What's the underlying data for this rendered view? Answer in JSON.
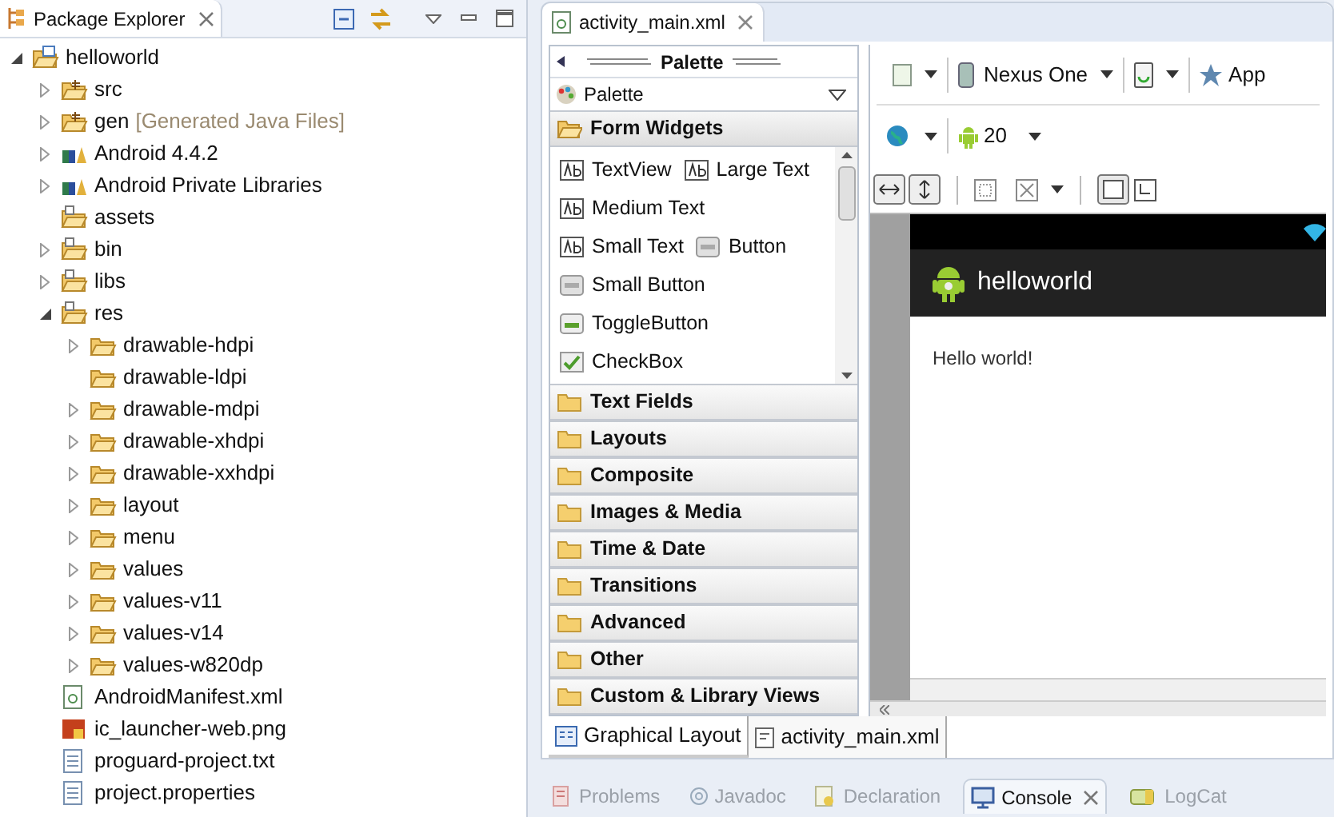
{
  "package_explorer": {
    "title": "Package Explorer",
    "tree": [
      {
        "label": "helloworld",
        "kind": "project",
        "expanded": true,
        "children": [
          {
            "label": "src",
            "kind": "package-folder",
            "expanded": false
          },
          {
            "label": "gen",
            "note": "[Generated Java Files]",
            "kind": "package-folder",
            "expanded": false
          },
          {
            "label": "Android 4.4.2",
            "kind": "library",
            "expanded": false
          },
          {
            "label": "Android Private Libraries",
            "kind": "library",
            "expanded": false
          },
          {
            "label": "assets",
            "kind": "source-folder"
          },
          {
            "label": "bin",
            "kind": "source-folder",
            "expanded": false
          },
          {
            "label": "libs",
            "kind": "source-folder",
            "expanded": false
          },
          {
            "label": "res",
            "kind": "source-folder",
            "expanded": true,
            "children": [
              {
                "label": "drawable-hdpi",
                "kind": "folder",
                "expanded": false
              },
              {
                "label": "drawable-ldpi",
                "kind": "folder"
              },
              {
                "label": "drawable-mdpi",
                "kind": "folder",
                "expanded": false
              },
              {
                "label": "drawable-xhdpi",
                "kind": "folder",
                "expanded": false
              },
              {
                "label": "drawable-xxhdpi",
                "kind": "folder",
                "expanded": false
              },
              {
                "label": "layout",
                "kind": "folder",
                "expanded": false
              },
              {
                "label": "menu",
                "kind": "folder",
                "expanded": false
              },
              {
                "label": "values",
                "kind": "folder",
                "expanded": false
              },
              {
                "label": "values-v11",
                "kind": "folder",
                "expanded": false
              },
              {
                "label": "values-v14",
                "kind": "folder",
                "expanded": false
              },
              {
                "label": "values-w820dp",
                "kind": "folder",
                "expanded": false
              }
            ]
          },
          {
            "label": "AndroidManifest.xml",
            "kind": "xml-file"
          },
          {
            "label": "ic_launcher-web.png",
            "kind": "image-file"
          },
          {
            "label": "proguard-project.txt",
            "kind": "text-file"
          },
          {
            "label": "project.properties",
            "kind": "text-file"
          }
        ]
      }
    ]
  },
  "editor": {
    "tab": "activity_main.xml",
    "palette": {
      "header": "Palette",
      "dropdown": "Palette",
      "sections": [
        {
          "label": "Form Widgets",
          "expanded": true,
          "rows": [
            [
              {
                "label": "TextView",
                "kind": "text"
              },
              {
                "label": "Large Text",
                "kind": "text"
              }
            ],
            [
              {
                "label": "Medium Text",
                "kind": "text"
              }
            ],
            [
              {
                "label": "Small Text",
                "kind": "text"
              },
              {
                "label": "Button",
                "kind": "button"
              }
            ],
            [
              {
                "label": "Small Button",
                "kind": "button"
              }
            ],
            [
              {
                "label": "ToggleButton",
                "kind": "toggle"
              }
            ],
            [
              {
                "label": "CheckBox",
                "kind": "checkbox"
              }
            ]
          ]
        },
        {
          "label": "Text Fields",
          "expanded": false
        },
        {
          "label": "Layouts",
          "expanded": false
        },
        {
          "label": "Composite",
          "expanded": false
        },
        {
          "label": "Images & Media",
          "expanded": false
        },
        {
          "label": "Time & Date",
          "expanded": false
        },
        {
          "label": "Transitions",
          "expanded": false
        },
        {
          "label": "Advanced",
          "expanded": false
        },
        {
          "label": "Other",
          "expanded": false
        },
        {
          "label": "Custom & Library Views",
          "expanded": false
        }
      ]
    },
    "toolbar": {
      "device": "Nexus One",
      "theme": "App",
      "api": "20"
    },
    "preview": {
      "app_title": "helloworld",
      "body": "Hello world!"
    },
    "view_tabs": [
      {
        "label": "Graphical Layout",
        "selected": true
      },
      {
        "label": "activity_main.xml",
        "selected": false
      }
    ]
  },
  "bottom_tabs": [
    {
      "label": "Problems",
      "kind": "problems",
      "selected": false
    },
    {
      "label": "Javadoc",
      "kind": "javadoc",
      "selected": false
    },
    {
      "label": "Declaration",
      "kind": "declaration",
      "selected": false
    },
    {
      "label": "Console",
      "kind": "console",
      "selected": true
    },
    {
      "label": "LogCat",
      "kind": "logcat",
      "selected": false
    }
  ]
}
